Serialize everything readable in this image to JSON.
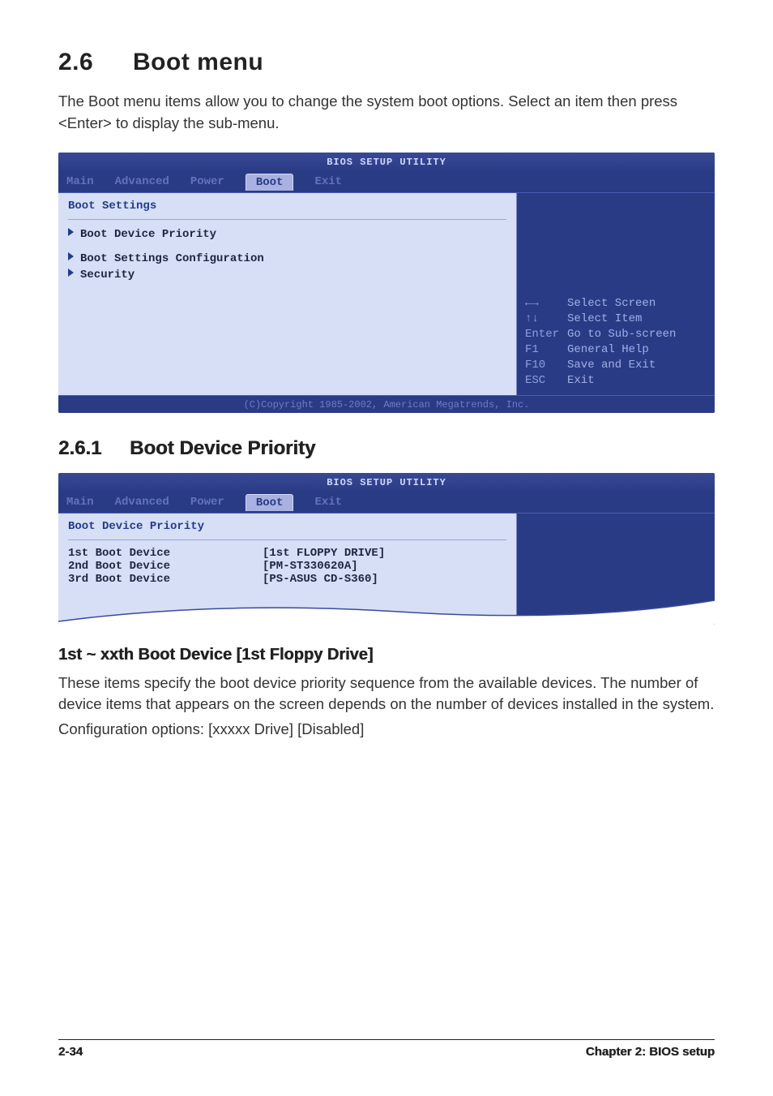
{
  "section": {
    "number": "2.6",
    "title": "Boot menu"
  },
  "intro": "The Boot menu items allow you to change the system boot options. Select an item then press <Enter> to display the sub-menu.",
  "bios1": {
    "title": "BIOS SETUP UTILITY",
    "tabs": {
      "main": "Main",
      "advanced": "Advanced",
      "power": "Power",
      "boot": "Boot",
      "exit": "Exit"
    },
    "pane_title": "Boot Settings",
    "items": {
      "priority": "Boot Device Priority",
      "config": "Boot Settings Configuration",
      "security": "Security"
    },
    "help": {
      "lr_key": "←→",
      "lr_action": "Select Screen",
      "ud_key": "↑↓",
      "ud_action": "Select Item",
      "enter_key": "Enter",
      "enter_action": "Go to Sub-screen",
      "f1_key": "F1",
      "f1_action": "General Help",
      "f10_key": "F10",
      "f10_action": "Save and Exit",
      "esc_key": "ESC",
      "esc_action": "Exit"
    },
    "footer": "(C)Copyright 1985-2002, American Megatrends, Inc."
  },
  "subsection": {
    "number": "2.6.1",
    "title": "Boot Device Priority"
  },
  "bios2": {
    "title": "BIOS SETUP UTILITY",
    "tabs": {
      "main": "Main",
      "advanced": "Advanced",
      "power": "Power",
      "boot": "Boot",
      "exit": "Exit"
    },
    "pane_title": "Boot Device Priority",
    "rows": [
      {
        "label": "1st Boot Device",
        "value": "[1st FLOPPY DRIVE]"
      },
      {
        "label": "2nd Boot Device",
        "value": "[PM-ST330620A]"
      },
      {
        "label": "3rd Boot Device",
        "value": "[PS-ASUS CD-S360]"
      }
    ]
  },
  "option": {
    "heading": "1st ~ xxth Boot Device [1st Floppy Drive]",
    "p1": "These items specify the boot device priority sequence from the available devices. The number of device items that appears on the screen depends on the number of devices installed in the system.",
    "p2": "Configuration options: [xxxxx Drive] [Disabled]"
  },
  "footer": {
    "left": "2-34",
    "right": "Chapter 2: BIOS setup"
  }
}
